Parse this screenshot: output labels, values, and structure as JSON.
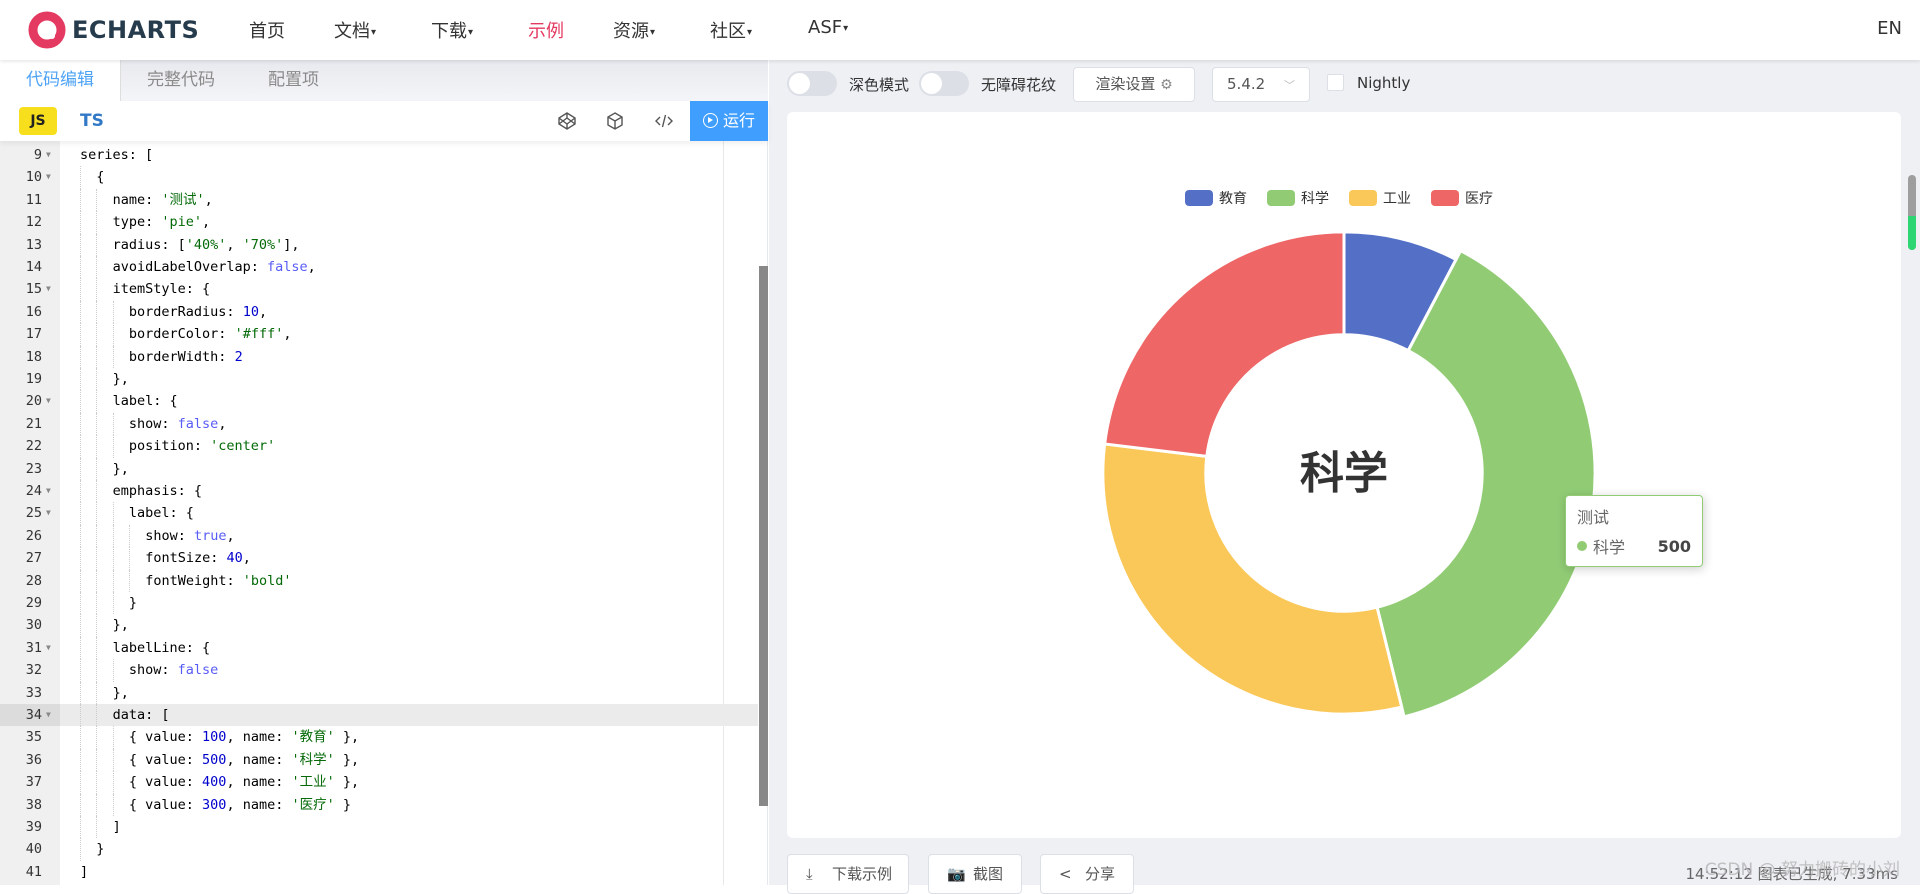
{
  "header": {
    "logo_text": "ECHARTS",
    "nav": [
      {
        "label": "首页",
        "dropdown": false,
        "active": false
      },
      {
        "label": "文档",
        "dropdown": true,
        "active": false
      },
      {
        "label": "下载",
        "dropdown": true,
        "active": false
      },
      {
        "label": "示例",
        "dropdown": false,
        "active": true
      },
      {
        "label": "资源",
        "dropdown": true,
        "active": false
      },
      {
        "label": "社区",
        "dropdown": true,
        "active": false
      },
      {
        "label": "ASF",
        "dropdown": true,
        "active": false
      }
    ],
    "caret": "▾",
    "lang": "EN",
    "brand_color": "#e43961"
  },
  "editor": {
    "tabs": [
      {
        "label": "代码编辑",
        "active": true
      },
      {
        "label": "完整代码",
        "active": false
      },
      {
        "label": "配置项",
        "active": false
      }
    ],
    "lang_js": "JS",
    "lang_ts": "TS",
    "tool_icons": [
      "codepen-icon",
      "codesandbox-icon",
      "code-format-icon"
    ],
    "run_label": "运行",
    "highlight_line": 34,
    "lines": [
      {
        "n": 9,
        "fold": true,
        "indent": 0,
        "code": "series: ["
      },
      {
        "n": 10,
        "fold": true,
        "indent": 1,
        "code": "{"
      },
      {
        "n": 11,
        "fold": false,
        "indent": 2,
        "code": "name: '测试',"
      },
      {
        "n": 12,
        "fold": false,
        "indent": 2,
        "code": "type: 'pie',"
      },
      {
        "n": 13,
        "fold": false,
        "indent": 2,
        "code": "radius: ['40%', '70%'],"
      },
      {
        "n": 14,
        "fold": false,
        "indent": 2,
        "code": "avoidLabelOverlap: false,"
      },
      {
        "n": 15,
        "fold": true,
        "indent": 2,
        "code": "itemStyle: {"
      },
      {
        "n": 16,
        "fold": false,
        "indent": 3,
        "code": "borderRadius: 10,"
      },
      {
        "n": 17,
        "fold": false,
        "indent": 3,
        "code": "borderColor: '#fff',"
      },
      {
        "n": 18,
        "fold": false,
        "indent": 3,
        "code": "borderWidth: 2"
      },
      {
        "n": 19,
        "fold": false,
        "indent": 2,
        "code": "},"
      },
      {
        "n": 20,
        "fold": true,
        "indent": 2,
        "code": "label: {"
      },
      {
        "n": 21,
        "fold": false,
        "indent": 3,
        "code": "show: false,"
      },
      {
        "n": 22,
        "fold": false,
        "indent": 3,
        "code": "position: 'center'"
      },
      {
        "n": 23,
        "fold": false,
        "indent": 2,
        "code": "},"
      },
      {
        "n": 24,
        "fold": true,
        "indent": 2,
        "code": "emphasis: {"
      },
      {
        "n": 25,
        "fold": true,
        "indent": 3,
        "code": "label: {"
      },
      {
        "n": 26,
        "fold": false,
        "indent": 4,
        "code": "show: true,"
      },
      {
        "n": 27,
        "fold": false,
        "indent": 4,
        "code": "fontSize: 40,"
      },
      {
        "n": 28,
        "fold": false,
        "indent": 4,
        "code": "fontWeight: 'bold'"
      },
      {
        "n": 29,
        "fold": false,
        "indent": 3,
        "code": "}"
      },
      {
        "n": 30,
        "fold": false,
        "indent": 2,
        "code": "},"
      },
      {
        "n": 31,
        "fold": true,
        "indent": 2,
        "code": "labelLine: {"
      },
      {
        "n": 32,
        "fold": false,
        "indent": 3,
        "code": "show: false"
      },
      {
        "n": 33,
        "fold": false,
        "indent": 2,
        "code": "},"
      },
      {
        "n": 34,
        "fold": true,
        "indent": 2,
        "code": "data: ["
      },
      {
        "n": 35,
        "fold": false,
        "indent": 3,
        "code": "{ value: 100, name: '教育' },"
      },
      {
        "n": 36,
        "fold": false,
        "indent": 3,
        "code": "{ value: 500, name: '科学' },"
      },
      {
        "n": 37,
        "fold": false,
        "indent": 3,
        "code": "{ value: 400, name: '工业' },"
      },
      {
        "n": 38,
        "fold": false,
        "indent": 3,
        "code": "{ value: 300, name: '医疗' }"
      },
      {
        "n": 39,
        "fold": false,
        "indent": 2,
        "code": "]"
      },
      {
        "n": 40,
        "fold": false,
        "indent": 1,
        "code": "}"
      },
      {
        "n": 41,
        "fold": false,
        "indent": 0,
        "code": "]"
      }
    ]
  },
  "preview": {
    "dark_mode_label": "深色模式",
    "decal_label": "无障碍花纹",
    "render_settings_label": "渲染设置",
    "version": "5.4.2",
    "nightly_label": "Nightly",
    "download_label": "下载示例",
    "screenshot_label": "截图",
    "share_label": "分享",
    "status_text": "14:52:12  图表已生成, 7.33ms",
    "watermark": "CSDN @ 努力搬砖的小刘"
  },
  "tooltip": {
    "series_name": "测试",
    "item_name": "科学",
    "item_value": "500",
    "item_color": "#91cc75"
  },
  "chart_data": {
    "type": "pie",
    "variant": "donut",
    "series_name": "测试",
    "inner_radius_pct": 40,
    "outer_radius_pct": 70,
    "categories": [
      "教育",
      "科学",
      "工业",
      "医疗"
    ],
    "values": [
      100,
      500,
      400,
      300
    ],
    "colors": [
      "#5470c6",
      "#91cc75",
      "#fac858",
      "#ee6666"
    ],
    "legend": {
      "entries": [
        "教育",
        "科学",
        "工业",
        "医疗"
      ],
      "placement": "top-center"
    },
    "emphasized": "科学",
    "center_label": "科学"
  }
}
